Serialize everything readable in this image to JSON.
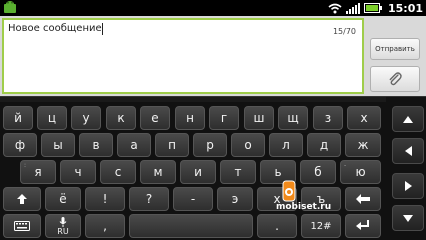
{
  "status_bar": {
    "time": "15:01",
    "icons": [
      "android-icon",
      "wifi-icon",
      "signal-icon",
      "battery-icon"
    ]
  },
  "compose": {
    "message_text": "Новое сообщение",
    "counter": "15/70",
    "send_label": "Отправить",
    "attach_icon": "paperclip-icon",
    "border_color": "#9fcd4a"
  },
  "keyboard": {
    "row1": [
      "й",
      "ц",
      "у",
      "к",
      "е",
      "н",
      "г",
      "ш",
      "щ",
      "з",
      "х"
    ],
    "row2": [
      "ф",
      "ы",
      "в",
      "а",
      "п",
      "р",
      "о",
      "л",
      "д",
      "ж"
    ],
    "row3": [
      "я",
      "ч",
      "с",
      "м",
      "и",
      "т",
      "ь",
      "б",
      "ю"
    ],
    "row3_hints": [
      ":",
      "-"
    ],
    "row4": [
      "ё",
      "!",
      "?",
      "-",
      "э",
      "х",
      "ъ"
    ],
    "row5": {
      "mic_lang": "RU",
      "comma": ",",
      "period": ".",
      "mode": "12#"
    },
    "side_keys": [
      "arrow-up-icon",
      "arrow-left-icon",
      "arrow-right-icon",
      "arrow-down-icon"
    ]
  },
  "watermark": {
    "text": "mobiset.ru"
  }
}
